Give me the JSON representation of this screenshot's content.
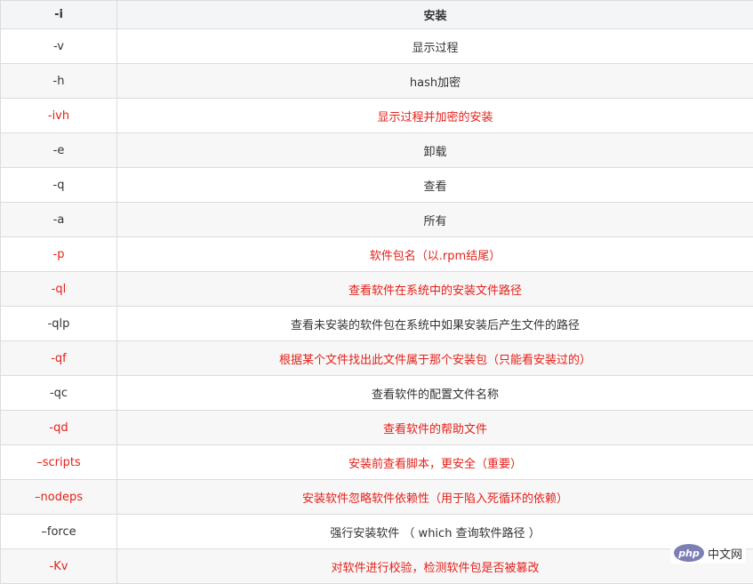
{
  "header": {
    "option": "-i",
    "description": "安装"
  },
  "colors": {
    "highlight": "#e3211a",
    "normal": "#333333"
  },
  "rows": [
    {
      "option": "-v",
      "description": "显示过程",
      "highlight": false
    },
    {
      "option": "-h",
      "description": "hash加密",
      "highlight": false
    },
    {
      "option": "-ivh",
      "description": "显示过程并加密的安装",
      "highlight": true
    },
    {
      "option": "-e",
      "description": "卸载",
      "highlight": false
    },
    {
      "option": "-q",
      "description": "查看",
      "highlight": false
    },
    {
      "option": "-a",
      "description": "所有",
      "highlight": false
    },
    {
      "option": "-p",
      "description": "软件包名（以.rpm结尾）",
      "highlight": true
    },
    {
      "option": "-ql",
      "description": "查看软件在系统中的安装文件路径",
      "highlight": true
    },
    {
      "option": "-qlp",
      "description": "查看未安装的软件包在系统中如果安装后产生文件的路径",
      "highlight": false
    },
    {
      "option": "-qf",
      "description": "根据某个文件找出此文件属于那个安装包（只能看安装过的）",
      "highlight": true
    },
    {
      "option": "-qc",
      "description": "查看软件的配置文件名称",
      "highlight": false
    },
    {
      "option": "-qd",
      "description": "查看软件的帮助文件",
      "highlight": true
    },
    {
      "option": "–scripts",
      "description": "安装前查看脚本，更安全（重要）",
      "highlight": true
    },
    {
      "option": "–nodeps",
      "description": "安装软件忽略软件依赖性（用于陷入死循环的依赖）",
      "highlight": true
    },
    {
      "option": "–force",
      "description": "强行安装软件 （ which 查询软件路径 ）",
      "highlight": false
    },
    {
      "option": "-Kv",
      "description": "对软件进行校验，检测软件包是否被篡改",
      "highlight": true
    }
  ],
  "watermark": {
    "logo": "php",
    "text": "中文网"
  }
}
